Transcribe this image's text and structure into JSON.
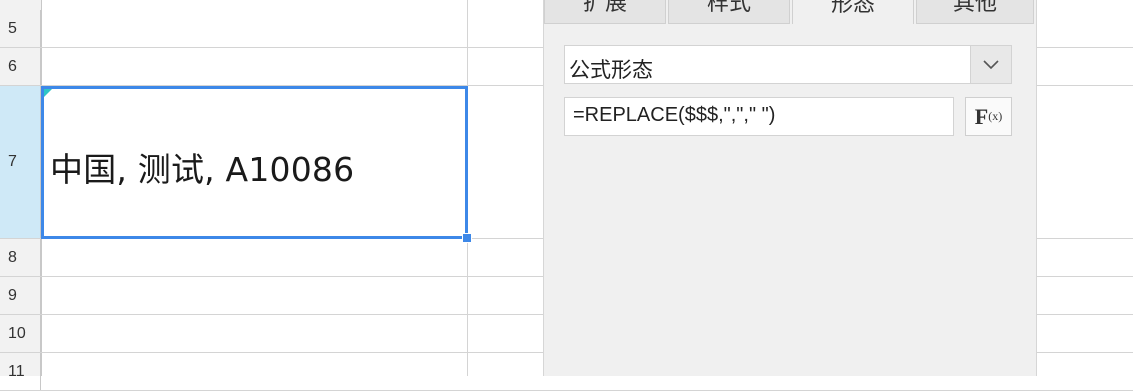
{
  "sheet": {
    "rows": [
      {
        "label": "5"
      },
      {
        "label": "6"
      },
      {
        "label": "7"
      },
      {
        "label": "8"
      },
      {
        "label": "9"
      },
      {
        "label": "10"
      },
      {
        "label": "11"
      }
    ],
    "active_cell_value": "中国, 测试, A10086",
    "selection_color": "#3d88e8",
    "selected_row_header_color": "#cfe9f7"
  },
  "panel": {
    "tabs": [
      {
        "label": "扩展"
      },
      {
        "label": "样式"
      },
      {
        "label": "形态"
      },
      {
        "label": "其他"
      }
    ],
    "active_tab": "形态",
    "form_type": {
      "selected": "公式形态",
      "icon": "chevron-down-icon"
    },
    "formula": {
      "value": "=REPLACE($$$,\",\",\" \")",
      "button_label_main": "F",
      "button_label_sub": "(x)",
      "icon": "function-icon"
    }
  }
}
